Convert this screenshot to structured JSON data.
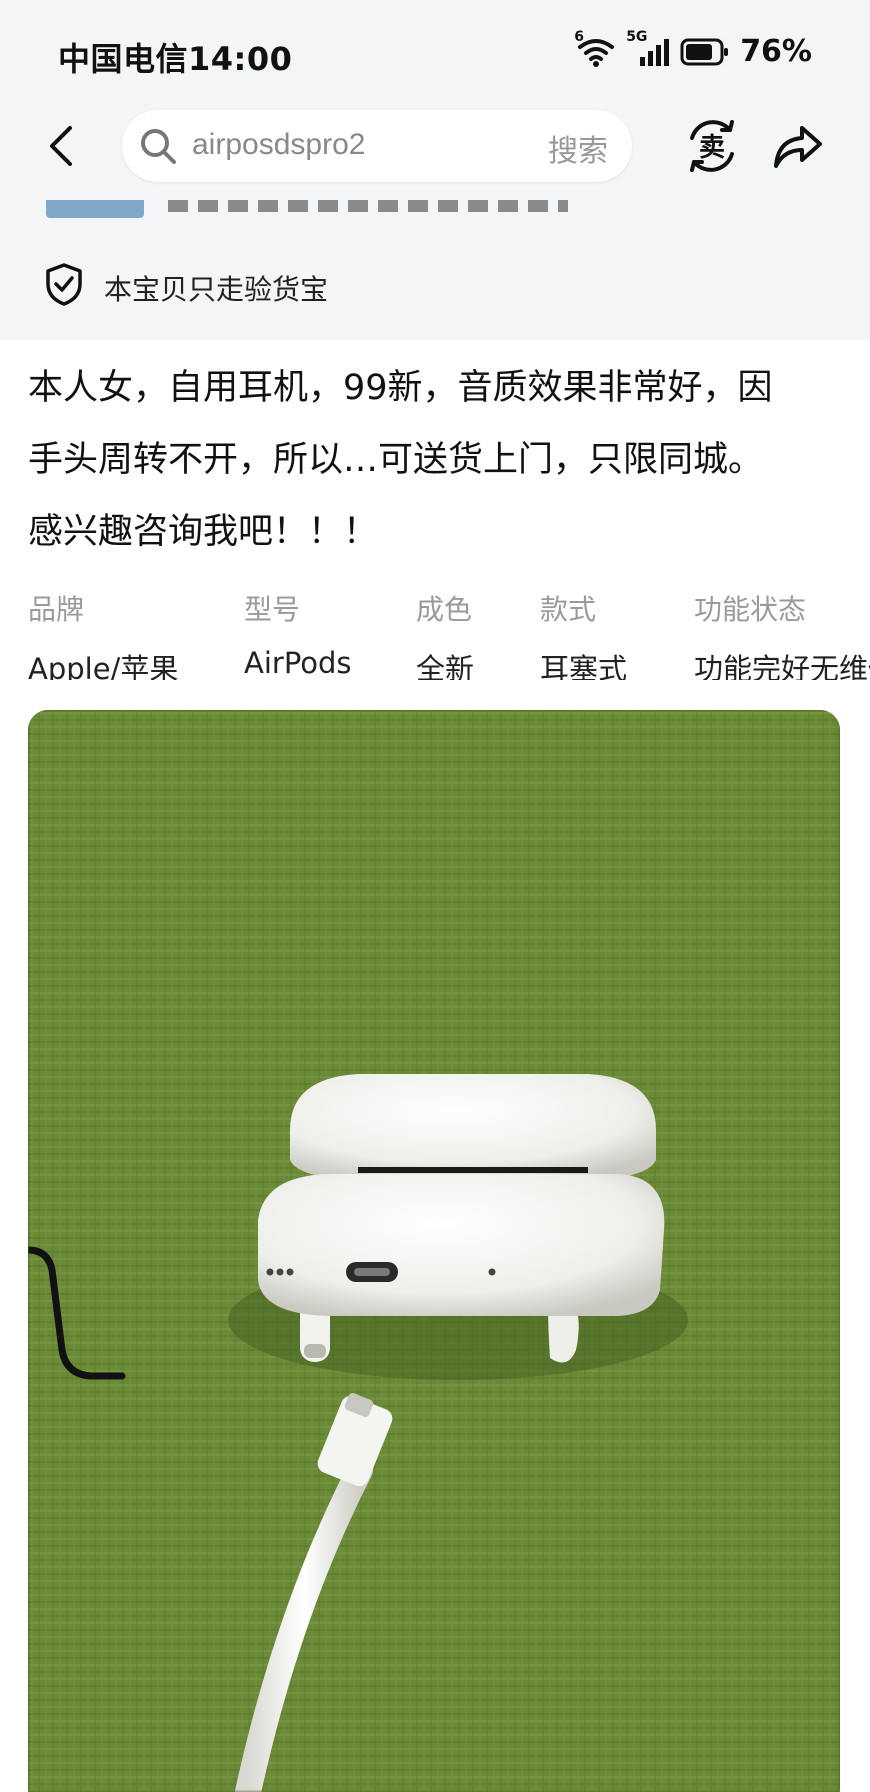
{
  "status_bar": {
    "carrier_time": "中国电信14:00",
    "signal_6": "6",
    "signal_5g": "5G",
    "battery": "76%"
  },
  "header": {
    "search_query": "airposdspro2",
    "search_button": "搜索",
    "sell_icon_label": "卖"
  },
  "verify": {
    "text": "本宝贝只走验货宝"
  },
  "description": {
    "lines": [
      "本人女，自用耳机，99新，音质效果非常好，因",
      "手头周转不开，所以…可送货上门，只限同城。",
      "感兴趣咨询我吧！！！"
    ]
  },
  "attributes": [
    {
      "label": "品牌",
      "value": "Apple/苹果"
    },
    {
      "label": "型号",
      "value": "AirPods"
    },
    {
      "label": "成色",
      "value": "全新"
    },
    {
      "label": "款式",
      "value": "耳塞式"
    },
    {
      "label": "功能状态",
      "value": "功能完好无维修"
    }
  ],
  "colors": {
    "page_background": "#ffffff",
    "header_background": "#f4f5f7",
    "photo_background": "#6f8f3c"
  },
  "icons": [
    "back-arrow-icon",
    "search-icon",
    "sell-icon",
    "share-icon",
    "shield-check-icon",
    "wifi-icon",
    "signal-icon",
    "battery-icon"
  ]
}
